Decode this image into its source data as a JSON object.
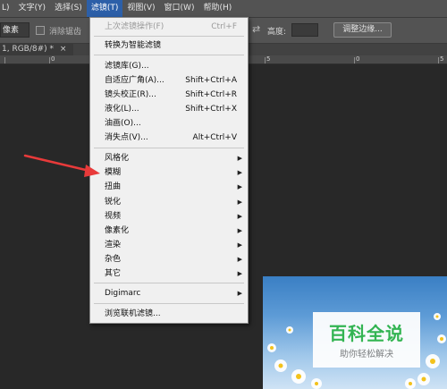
{
  "menubar": {
    "items": [
      "L)",
      "文字(Y)",
      "选择(S)",
      "滤镜(T)",
      "视图(V)",
      "窗口(W)",
      "帮助(H)"
    ]
  },
  "options_bar": {
    "field_value": "像素",
    "checkbox_label": "消除锯齿",
    "height_label": "高度:",
    "button_label": "调整边缘..."
  },
  "document": {
    "tab_label": "1, RGB/8#) *",
    "tab_close": "×",
    "ruler_numbers": [
      "0",
      "5",
      "0",
      "5"
    ]
  },
  "filter_menu": {
    "items": [
      {
        "label": "上次滤镜操作(F)",
        "shortcut": "Ctrl+F",
        "disabled": true
      },
      {
        "label": "转换为智能滤镜"
      },
      {
        "label": "滤镜库(G)..."
      },
      {
        "label": "自适应广角(A)...",
        "shortcut": "Shift+Ctrl+A"
      },
      {
        "label": "镜头校正(R)...",
        "shortcut": "Shift+Ctrl+R"
      },
      {
        "label": "液化(L)...",
        "shortcut": "Shift+Ctrl+X"
      },
      {
        "label": "油画(O)..."
      },
      {
        "label": "消失点(V)...",
        "shortcut": "Alt+Ctrl+V"
      },
      {
        "label": "风格化",
        "submenu": true
      },
      {
        "label": "模糊",
        "submenu": true
      },
      {
        "label": "扭曲",
        "submenu": true
      },
      {
        "label": "锐化",
        "submenu": true
      },
      {
        "label": "视频",
        "submenu": true
      },
      {
        "label": "像素化",
        "submenu": true
      },
      {
        "label": "渲染",
        "submenu": true
      },
      {
        "label": "杂色",
        "submenu": true
      },
      {
        "label": "其它",
        "submenu": true
      },
      {
        "label": "Digimarc",
        "submenu": true
      },
      {
        "label": "浏览联机滤镜..."
      }
    ],
    "submenu_arrow": "▶"
  },
  "watermark": {
    "title": "百科全说",
    "subtitle": "助你轻松解决"
  },
  "colors": {
    "menu_active": "#2c5fa8",
    "annotation_arrow": "#e83a3a",
    "watermark_green": "#2fb54a"
  }
}
